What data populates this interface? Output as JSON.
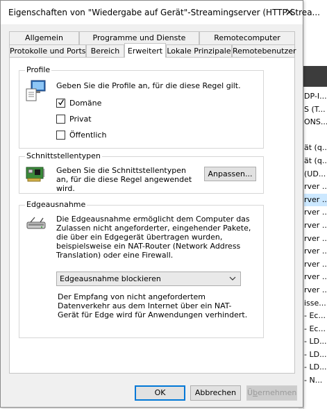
{
  "dialog": {
    "title": "Eigenschaften von \"Wiedergabe auf Gerät\"-Streamingserver (HTTP-Strea...",
    "close_glyph": "✕"
  },
  "tabs": {
    "row1": [
      {
        "label": "Allgemein"
      },
      {
        "label": "Programme und Dienste"
      },
      {
        "label": "Remotecomputer"
      }
    ],
    "row2": [
      {
        "label": "Protokolle und Ports"
      },
      {
        "label": "Bereich"
      },
      {
        "label": "Erweitert",
        "active": true
      },
      {
        "label": "Lokale Prinzipale"
      },
      {
        "label": "Remotebenutzer"
      }
    ]
  },
  "profiles": {
    "title": "Profile",
    "description": "Geben Sie die Profile an, für die diese Regel gilt.",
    "icon": "computer-profile-icon",
    "options": [
      {
        "label": "Domäne",
        "checked": true
      },
      {
        "label": "Privat",
        "checked": false
      },
      {
        "label": "Öffentlich",
        "checked": false
      }
    ]
  },
  "interfaces": {
    "title": "Schnittstellentypen",
    "description": "Geben Sie die Schnittstellentypen an, für die diese Regel angewendet wird.",
    "icon": "network-card-icon",
    "button_label": "Anpassen..."
  },
  "edge": {
    "title": "Edgeausnahme",
    "description": "Die Edgeausnahme ermöglicht dem Computer das Zulassen nicht angeforderter, eingehender Pakete, die über ein Edgegerät übertragen wurden, beispielsweise ein NAT-Router (Network Address Translation) oder eine Firewall.",
    "icon": "router-icon",
    "select_value": "Edgeausnahme blockieren",
    "explanation": "Der Empfang von nicht angefordertem Datenverkehr aus dem Internet über ein NAT-Gerät für Edge wird für Anwendungen verhindert."
  },
  "buttons": {
    "ok": "OK",
    "cancel": "Abbrechen",
    "apply": "Übernehmen"
  },
  "background_list": [
    {
      "text": "DP-I..."
    },
    {
      "text": "S (T..."
    },
    {
      "text": "ONS..."
    },
    {
      "text": ""
    },
    {
      "text": "ät (q..."
    },
    {
      "text": "ät (q..."
    },
    {
      "text": "(UD..."
    },
    {
      "text": "rver ..."
    },
    {
      "text": "rver ...",
      "selected": true
    },
    {
      "text": "rver ..."
    },
    {
      "text": "rver ..."
    },
    {
      "text": "rver ..."
    },
    {
      "text": "rver ..."
    },
    {
      "text": "rver ..."
    },
    {
      "text": "rver ..."
    },
    {
      "text": "rver ..."
    },
    {
      "text": "isse..."
    },
    {
      "text": "- Ec..."
    },
    {
      "text": "- Ec..."
    },
    {
      "text": "- LD..."
    },
    {
      "text": "- LD..."
    },
    {
      "text": "- LD..."
    },
    {
      "text": "- N..."
    }
  ]
}
